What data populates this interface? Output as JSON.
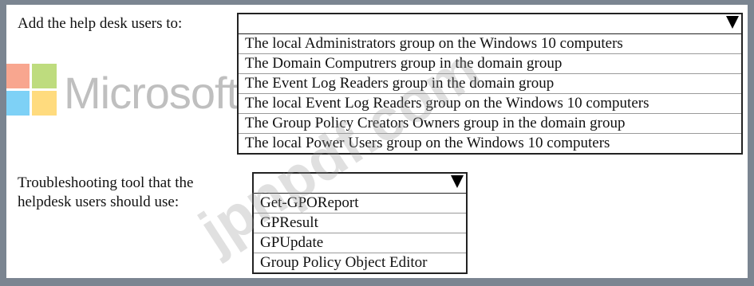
{
  "section1": {
    "label": "Add the help desk users to:",
    "options": [
      "The local Administrators group on the Windows 10 computers",
      "The Domain Computrers group in the domain group",
      "The Event Log Readers group in the domain group",
      "The local Event Log Readers group on the Windows 10 computers",
      "The Group Policy Creators Owners group in the domain group",
      "The local Power Users group on the Windows 10 computers"
    ]
  },
  "section2": {
    "label_line1": "Troubleshooting tool that the",
    "label_line2": "helpdesk users should use:",
    "options": [
      "Get-GPOReport",
      "GPResult",
      "GPUpdate",
      "Group Policy Object Editor"
    ]
  },
  "watermark": {
    "brand": "Microsoft",
    "site": "jpnpdf.com",
    "logo_colors": [
      "#f25022",
      "#7fba00",
      "#00a4ef",
      "#ffb900"
    ]
  }
}
